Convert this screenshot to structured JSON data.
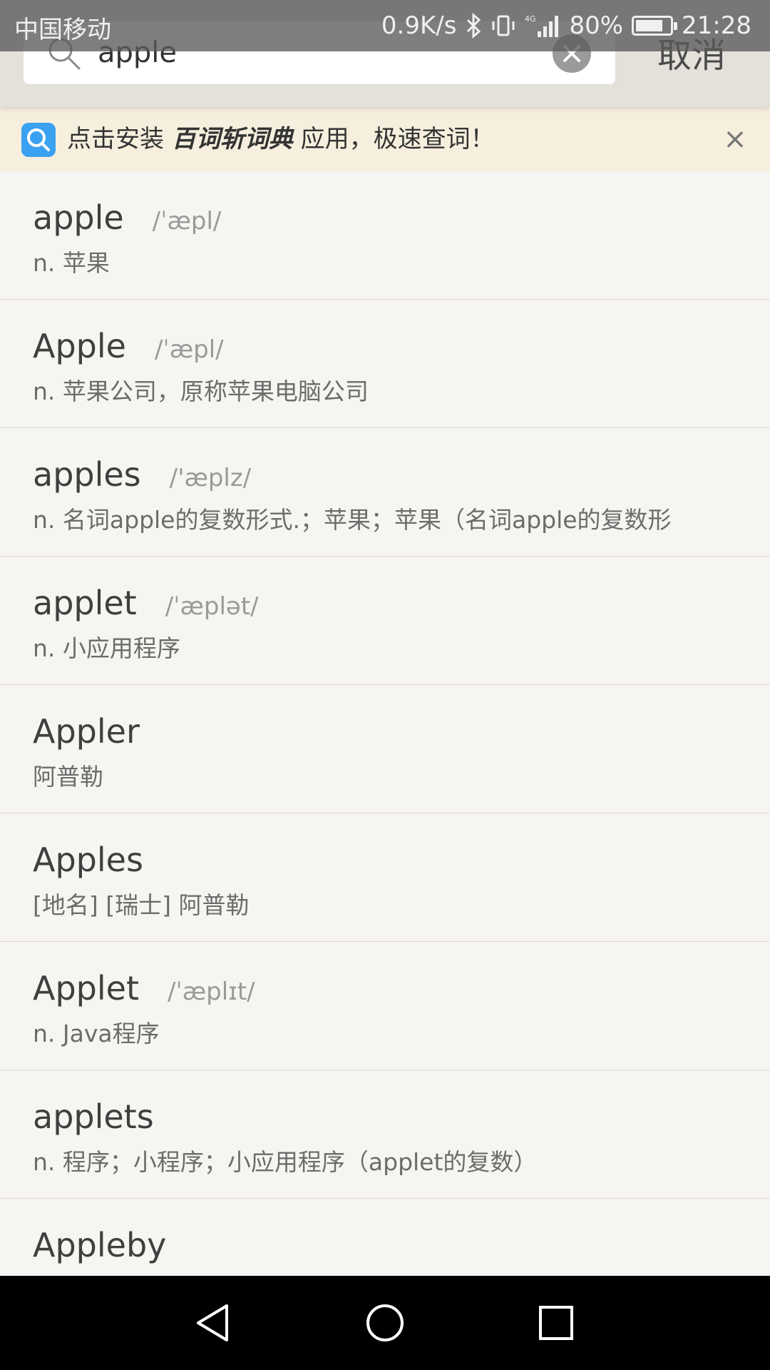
{
  "status_bar": {
    "carrier": "中国移动",
    "network_speed": "0.9K/s",
    "network_type": "4G",
    "battery_percent": "80%",
    "battery_level": 0.8,
    "time": "21:28",
    "icons": [
      "bluetooth-icon",
      "vibrate-icon",
      "signal-icon",
      "battery-icon"
    ]
  },
  "search": {
    "value": "apple",
    "placeholder": "",
    "cancel_label": "取消"
  },
  "banner": {
    "text_before": "点击安装",
    "app_name": "百词斩词典",
    "text_after": "应用，极速查词！",
    "close_label": "×"
  },
  "results": [
    {
      "word": "apple",
      "phonetic": "/ˈæpl/",
      "definition": "n. 苹果"
    },
    {
      "word": "Apple",
      "phonetic": "/ˈæpl/",
      "definition": "n. 苹果公司，原称苹果电脑公司"
    },
    {
      "word": "apples",
      "phonetic": "/'æplz/",
      "definition": "n. 名词apple的复数形式.；苹果；苹果（名词apple的复数形"
    },
    {
      "word": "applet",
      "phonetic": "/ˈæplət/",
      "definition": "n. 小应用程序"
    },
    {
      "word": "Appler",
      "phonetic": "",
      "definition": "阿普勒"
    },
    {
      "word": "Apples",
      "phonetic": "",
      "definition": "[地名] [瑞士] 阿普勒"
    },
    {
      "word": "Applet",
      "phonetic": "/ˈæplɪt/",
      "definition": "n. Java程序"
    },
    {
      "word": "applets",
      "phonetic": "",
      "definition": "n. 程序；小程序；小应用程序（applet的复数）"
    },
    {
      "word": "Appleby",
      "phonetic": "",
      "definition": ""
    }
  ],
  "colors": {
    "background": "#f6f5f1",
    "banner_background": "#f6efde",
    "banner_icon": "#3aa2f0",
    "header_background": "#e4e0da"
  }
}
